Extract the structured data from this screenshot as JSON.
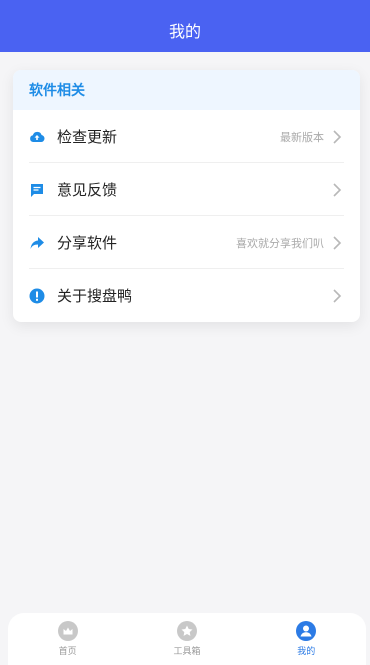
{
  "header": {
    "title": "我的"
  },
  "card": {
    "section_title": "软件相关",
    "rows": [
      {
        "icon": "cloud-upload-icon",
        "label": "检查更新",
        "sub": "最新版本"
      },
      {
        "icon": "message-icon",
        "label": "意见反馈",
        "sub": ""
      },
      {
        "icon": "share-icon",
        "label": "分享软件",
        "sub": "喜欢就分享我们叭"
      },
      {
        "icon": "info-icon",
        "label": "关于搜盘鸭",
        "sub": ""
      }
    ]
  },
  "tabbar": {
    "tabs": [
      {
        "label": "首页",
        "icon": "home-icon",
        "active": false
      },
      {
        "label": "工具箱",
        "icon": "star-icon",
        "active": false
      },
      {
        "label": "我的",
        "icon": "user-icon",
        "active": true
      }
    ]
  },
  "colors": {
    "brand": "#4a62f2",
    "accent": "#1e8ce6",
    "active_tab": "#2c7be5"
  }
}
